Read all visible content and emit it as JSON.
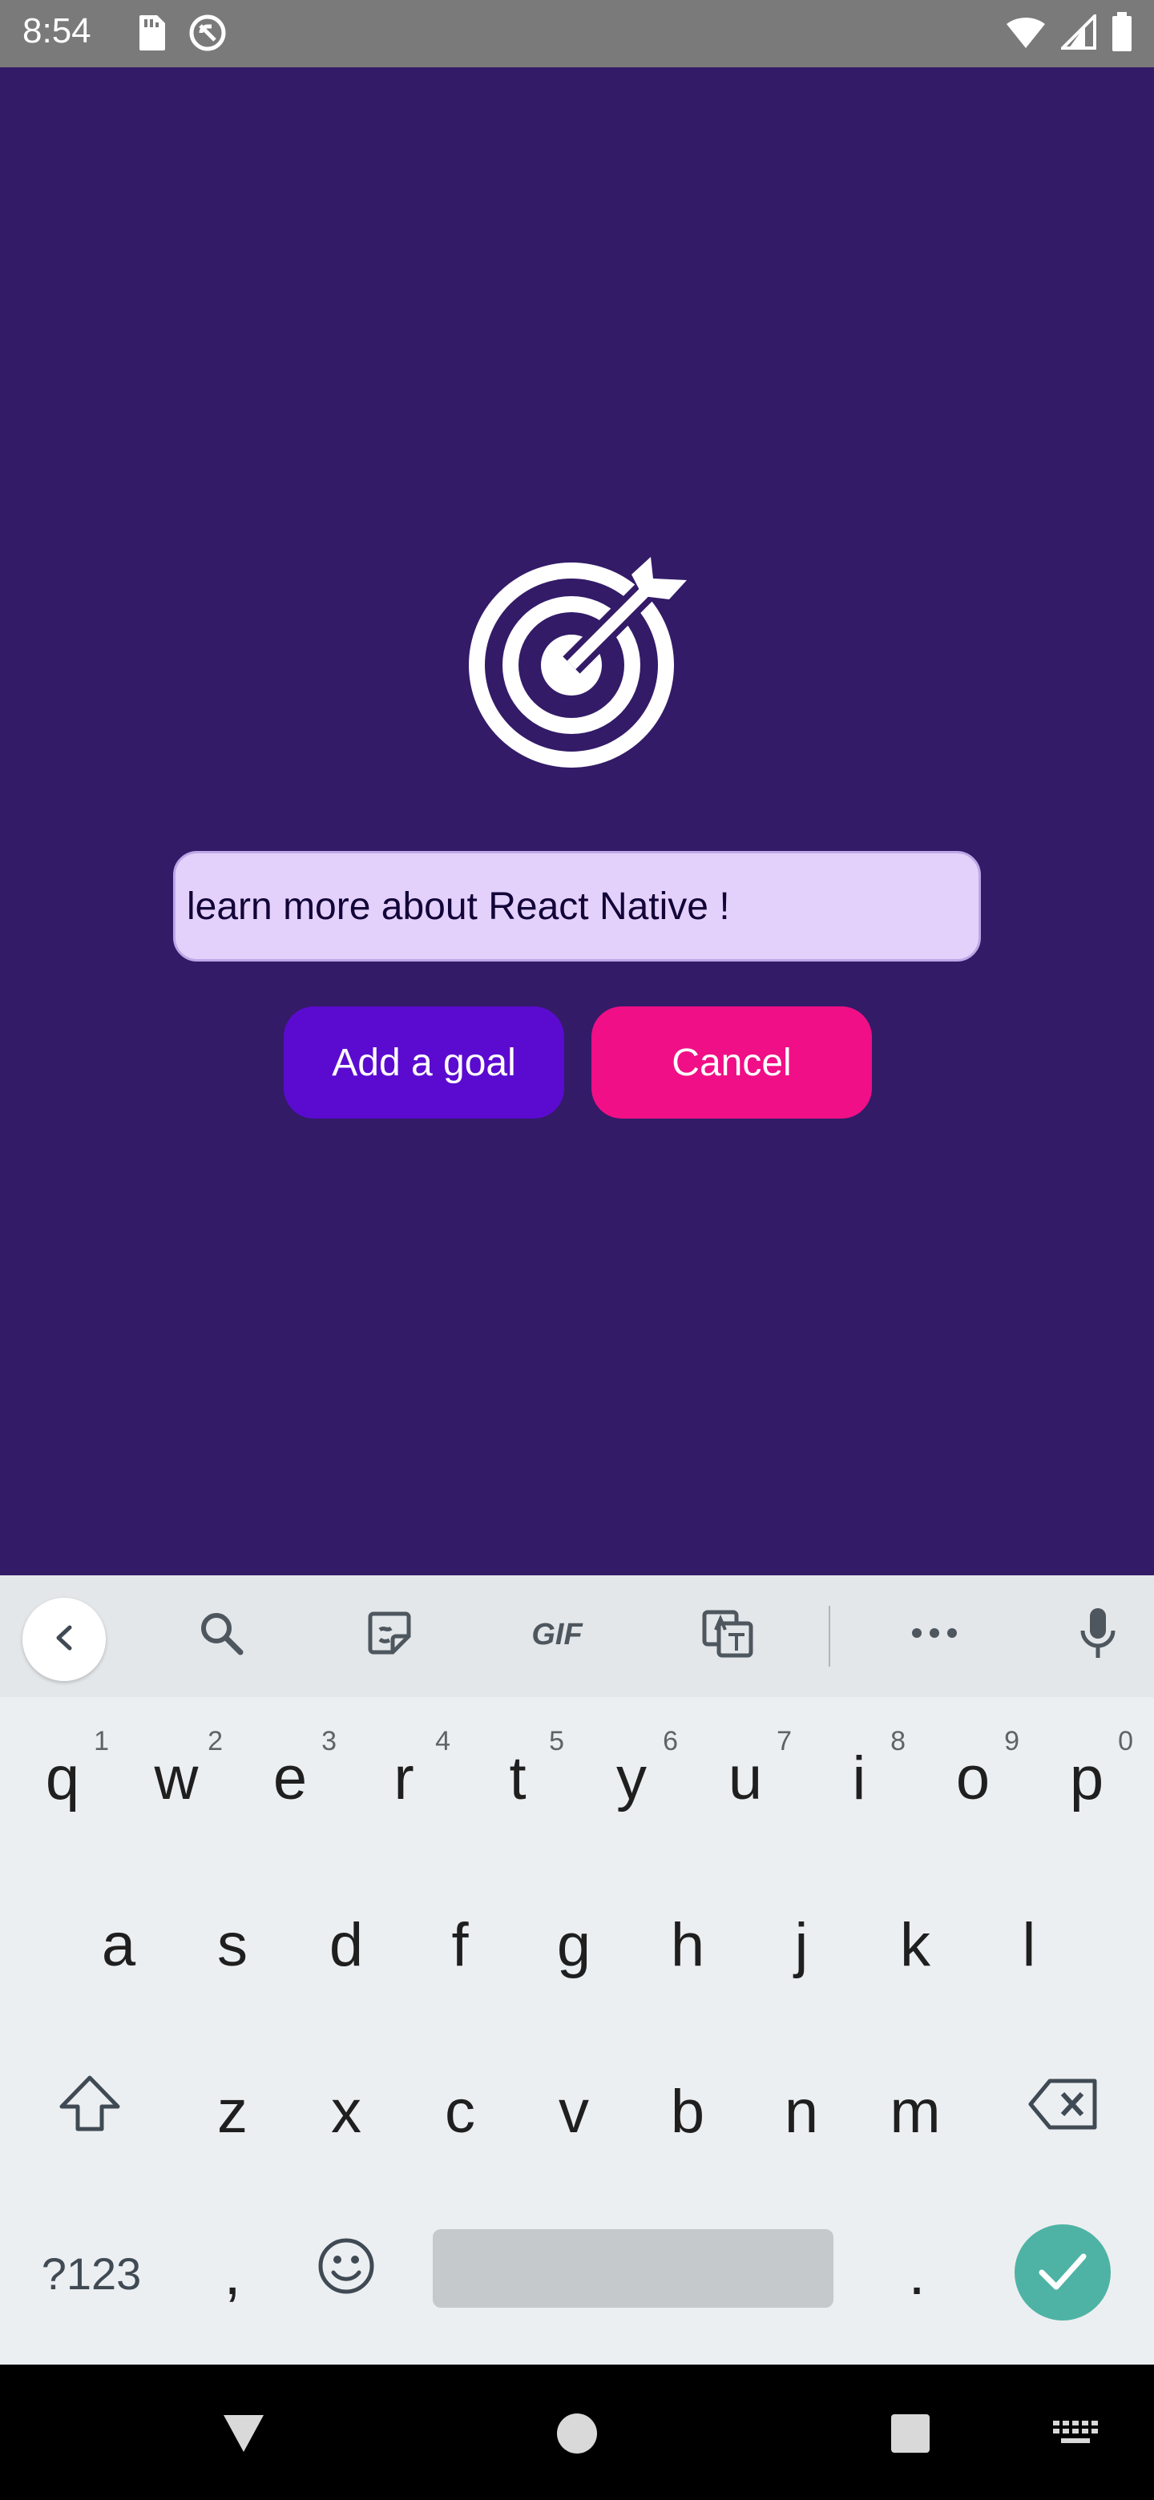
{
  "status_bar": {
    "time": "8:54",
    "icons": [
      "sd-card-icon",
      "do-not-disturb-icon",
      "wifi-icon",
      "signal-icon",
      "battery-icon"
    ]
  },
  "app": {
    "background_color": "#331b68",
    "icon": "target-arrow-icon",
    "goal_input": {
      "value": "learn more about React Native !",
      "placeholder": ""
    },
    "add_button_label": "Add a goal",
    "cancel_button_label": "Cancel",
    "add_button_color": "#5b0bd0",
    "cancel_button_color": "#f00f86"
  },
  "keyboard": {
    "toolbar": {
      "gif_label": "GIF",
      "icons": [
        "back-icon",
        "search-icon",
        "sticker-icon",
        "gif-icon",
        "translate-icon",
        "more-icon",
        "mic-icon"
      ]
    },
    "rows": [
      [
        {
          "label": "q",
          "hint": "1"
        },
        {
          "label": "w",
          "hint": "2"
        },
        {
          "label": "e",
          "hint": "3"
        },
        {
          "label": "r",
          "hint": "4"
        },
        {
          "label": "t",
          "hint": "5"
        },
        {
          "label": "y",
          "hint": "6"
        },
        {
          "label": "u",
          "hint": "7"
        },
        {
          "label": "i",
          "hint": "8"
        },
        {
          "label": "o",
          "hint": "9"
        },
        {
          "label": "p",
          "hint": "0"
        }
      ],
      [
        {
          "label": "a"
        },
        {
          "label": "s"
        },
        {
          "label": "d"
        },
        {
          "label": "f"
        },
        {
          "label": "g"
        },
        {
          "label": "h"
        },
        {
          "label": "j"
        },
        {
          "label": "k"
        },
        {
          "label": "l"
        }
      ],
      [
        {
          "label": "z"
        },
        {
          "label": "x"
        },
        {
          "label": "c"
        },
        {
          "label": "v"
        },
        {
          "label": "b"
        },
        {
          "label": "n"
        },
        {
          "label": "m"
        }
      ]
    ],
    "bottom_row": {
      "symbols_label": "?123",
      "comma": ",",
      "period": "."
    },
    "enter_color": "#4eb3a5"
  },
  "nav_bar": {
    "icons": [
      "back-triangle-icon",
      "home-circle-icon",
      "recents-square-icon",
      "keyboard-switch-icon"
    ]
  }
}
